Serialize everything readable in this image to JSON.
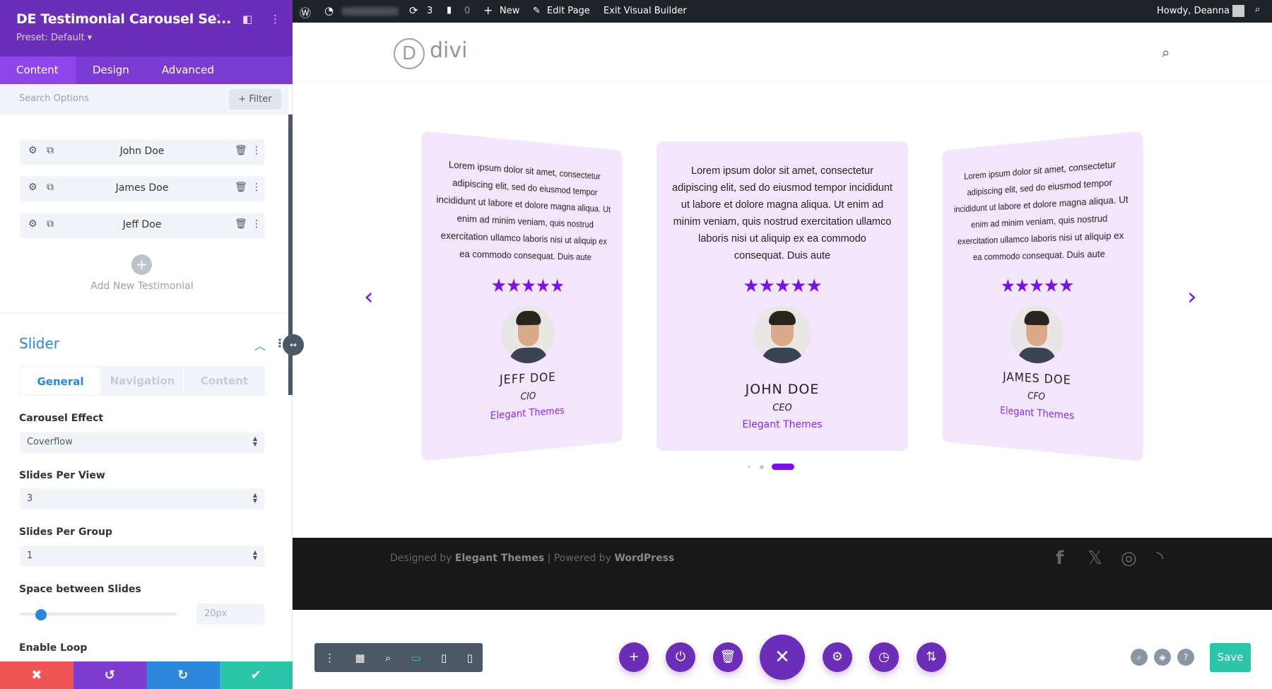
{
  "panel": {
    "title": "DE Testimonial Carousel Se...",
    "preset": "Preset: Default ▾",
    "tabs": [
      "Content",
      "Design",
      "Advanced"
    ],
    "search_placeholder": "Search Options",
    "filter": "+ Filter",
    "items": [
      {
        "name": "John Doe"
      },
      {
        "name": "James Doe"
      },
      {
        "name": "Jeff Doe"
      }
    ],
    "add_new": "Add New Testimonial",
    "section": "Slider",
    "subtabs": [
      "General",
      "Navigation",
      "Content"
    ],
    "fields": {
      "carousel_effect": {
        "label": "Carousel Effect",
        "value": "Coverflow"
      },
      "slides_per_view": {
        "label": "Slides Per View",
        "value": "3"
      },
      "slides_per_group": {
        "label": "Slides Per Group",
        "value": "1"
      },
      "space": {
        "label": "Space between Slides",
        "value": "20px",
        "slider_percent": 10
      },
      "loop": {
        "label": "Enable Loop"
      }
    }
  },
  "admin": {
    "updates": "3",
    "comments": "0",
    "new": "New",
    "edit": "Edit Page",
    "exit": "Exit Visual Builder",
    "howdy": "Howdy, Deanna"
  },
  "site": {
    "logo": "divi",
    "logo_letter": "D"
  },
  "testimonials": [
    {
      "text": "Lorem ipsum dolor sit amet, consectetur adipiscing elit, sed do eiusmod tempor incididunt ut labore et dolore magna aliqua. Ut enim ad minim veniam, quis nostrud exercitation ullamco laboris nisi ut aliquip ex ea commodo consequat. Duis aute",
      "stars": "★★★★★",
      "name": "JEFF DOE",
      "role": "CIO",
      "company": "Elegant Themes"
    },
    {
      "text": "Lorem ipsum dolor sit amet, consectetur adipiscing elit, sed do eiusmod tempor incididunt ut labore et dolore magna aliqua. Ut enim ad minim veniam, quis nostrud exercitation ullamco laboris nisi ut aliquip ex ea commodo consequat. Duis aute",
      "stars": "★★★★★",
      "name": "JOHN DOE",
      "role": "CEO",
      "company": "Elegant Themes"
    },
    {
      "text": "Lorem ipsum dolor sit amet, consectetur adipiscing elit, sed do eiusmod tempor incididunt ut labore et dolore magna aliqua. Ut enim ad minim veniam, quis nostrud exercitation ullamco laboris nisi ut aliquip ex ea commodo consequat. Duis aute",
      "stars": "★★★★★",
      "name": "JAMES DOE",
      "role": "CFO",
      "company": "Elegant Themes"
    }
  ],
  "footer": {
    "designed": "Designed by ",
    "et": "Elegant Themes",
    "sep": " | Powered by ",
    "wp": "WordPress"
  },
  "builder": {
    "save": "Save"
  },
  "colors": {
    "purple": "#6c2eb9",
    "accent": "#7a12e6",
    "blue": "#2b87da",
    "green": "#29c4a9",
    "red": "#ef5555"
  }
}
